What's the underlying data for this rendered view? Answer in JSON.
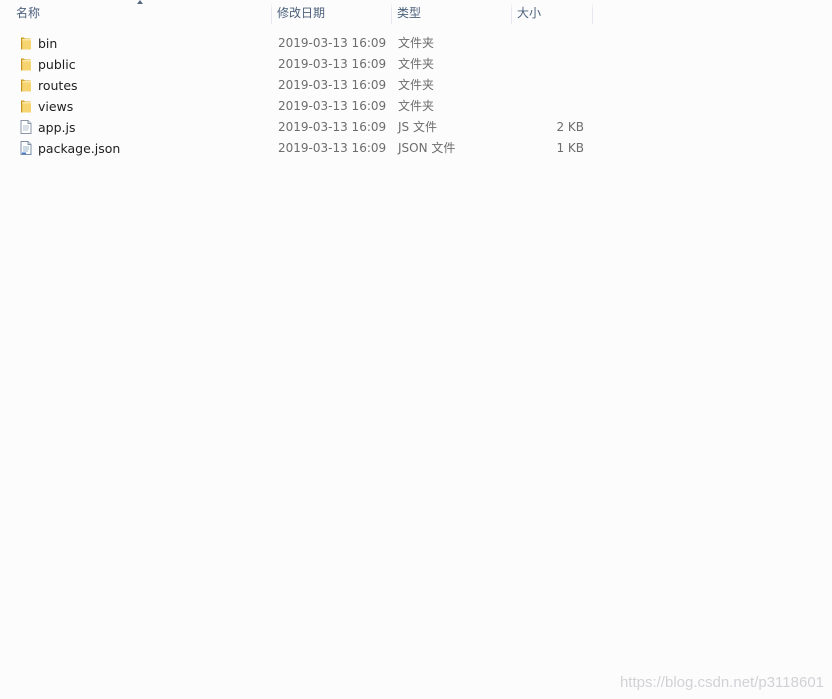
{
  "columns": {
    "name": "名称",
    "date": "修改日期",
    "type": "类型",
    "size": "大小"
  },
  "files": [
    {
      "name": "bin",
      "date": "2019-03-13 16:09",
      "type": "文件夹",
      "size": "",
      "icon": "folder-icon"
    },
    {
      "name": "public",
      "date": "2019-03-13 16:09",
      "type": "文件夹",
      "size": "",
      "icon": "folder-icon"
    },
    {
      "name": "routes",
      "date": "2019-03-13 16:09",
      "type": "文件夹",
      "size": "",
      "icon": "folder-icon"
    },
    {
      "name": "views",
      "date": "2019-03-13 16:09",
      "type": "文件夹",
      "size": "",
      "icon": "folder-icon"
    },
    {
      "name": "app.js",
      "date": "2019-03-13 16:09",
      "type": "JS 文件",
      "size": "2 KB",
      "icon": "js-file-icon"
    },
    {
      "name": "package.json",
      "date": "2019-03-13 16:09",
      "type": "JSON 文件",
      "size": "1 KB",
      "icon": "json-file-icon"
    }
  ],
  "watermark": "https://blog.csdn.net/p3118601",
  "colors": {
    "header_text": "#4c607a",
    "file_name": "#1e1e1e",
    "meta_text": "#6d6d6d",
    "folder_yellow": "#e8c04a"
  }
}
